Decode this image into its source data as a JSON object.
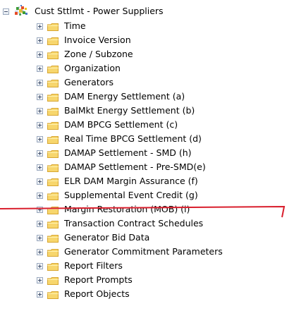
{
  "tree": {
    "root": {
      "label": "Cust Sttlmt - Power Suppliers",
      "icon": "star-cube-icon",
      "expanded": true
    },
    "items": [
      {
        "label": "Time",
        "icon": "folder-icon"
      },
      {
        "label": "Invoice Version",
        "icon": "folder-icon"
      },
      {
        "label": "Zone / Subzone",
        "icon": "folder-icon"
      },
      {
        "label": "Organization",
        "icon": "folder-icon"
      },
      {
        "label": "Generators",
        "icon": "folder-icon"
      },
      {
        "label": "DAM Energy Settlement (a)",
        "icon": "folder-icon"
      },
      {
        "label": "BalMkt Energy Settlement (b)",
        "icon": "folder-icon"
      },
      {
        "label": "DAM BPCG Settlement (c)",
        "icon": "folder-icon"
      },
      {
        "label": "Real Time BPCG Settlement (d)",
        "icon": "folder-icon"
      },
      {
        "label": "DAMAP Settlement - SMD (h)",
        "icon": "folder-icon"
      },
      {
        "label": "DAMAP Settlement - Pre-SMD(e)",
        "icon": "folder-icon"
      },
      {
        "label": "ELR DAM Margin Assurance (f)",
        "icon": "folder-icon"
      },
      {
        "label": "Supplemental Event Credit (g)",
        "icon": "folder-icon"
      },
      {
        "label": "Margin Restoration (MOB) (i)",
        "icon": "folder-icon"
      },
      {
        "label": "Transaction Contract Schedules",
        "icon": "folder-icon"
      },
      {
        "label": "Generator Bid Data",
        "icon": "folder-icon"
      },
      {
        "label": "Generator Commitment Parameters",
        "icon": "folder-icon"
      },
      {
        "label": "Report Filters",
        "icon": "folder-icon"
      },
      {
        "label": "Report Prompts",
        "icon": "folder-icon"
      },
      {
        "label": "Report Objects",
        "icon": "folder-icon"
      }
    ]
  },
  "colors": {
    "folder_fill": "#f7d66d",
    "folder_dark": "#d8a631",
    "expander_border": "#98a7bd",
    "annotation_line": "#d91f2d"
  }
}
